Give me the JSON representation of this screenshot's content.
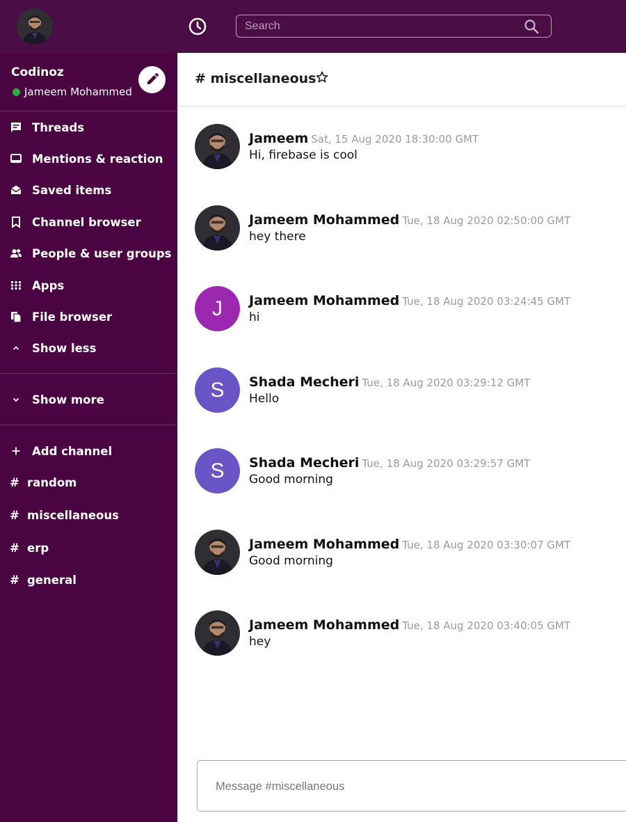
{
  "topbar": {
    "search_placeholder": "Search"
  },
  "sidebar": {
    "workspace_name": "Codinoz",
    "current_user": "Jameem Mohammed",
    "nav_items": [
      {
        "label": "Threads",
        "icon": "threads-icon"
      },
      {
        "label": "Mentions & reaction",
        "icon": "mentions-icon"
      },
      {
        "label": "Saved items",
        "icon": "saved-items-icon"
      },
      {
        "label": "Channel browser",
        "icon": "bookmark-icon"
      },
      {
        "label": "People & user groups",
        "icon": "people-icon"
      },
      {
        "label": "Apps",
        "icon": "apps-grid-icon"
      },
      {
        "label": "File browser",
        "icon": "files-icon"
      },
      {
        "label": "Show less",
        "icon": "chevron-up-icon"
      }
    ],
    "show_more": "Show more",
    "add_channel": "Add channel",
    "channels": [
      "random",
      "miscellaneous",
      "erp",
      "general"
    ]
  },
  "channel": {
    "title": "# miscellaneous"
  },
  "messages": [
    {
      "author": "Jameem",
      "time": "Sat, 15 Aug 2020 18:30:00 GMT",
      "text": "Hi, firebase is cool",
      "avatar": "photo"
    },
    {
      "author": "Jameem Mohammed",
      "time": "Tue, 18 Aug 2020 02:50:00 GMT",
      "text": "hey there",
      "avatar": "photo"
    },
    {
      "author": "Jameem Mohammed",
      "time": "Tue, 18 Aug 2020 03:24:45 GMT",
      "text": "hi",
      "avatar": "J",
      "avatar_color": "#9c27b0"
    },
    {
      "author": "Shada Mecheri",
      "time": "Tue, 18 Aug 2020 03:29:12 GMT",
      "text": "Hello",
      "avatar": "S",
      "avatar_color": "#6a55c7"
    },
    {
      "author": "Shada Mecheri",
      "time": "Tue, 18 Aug 2020 03:29:57 GMT",
      "text": "Good morning",
      "avatar": "S",
      "avatar_color": "#6a55c7"
    },
    {
      "author": "Jameem Mohammed",
      "time": "Tue, 18 Aug 2020 03:30:07 GMT",
      "text": "Good morning",
      "avatar": "photo"
    },
    {
      "author": "Jameem Mohammed",
      "time": "Tue, 18 Aug 2020 03:40:05 GMT",
      "text": "hey",
      "avatar": "photo"
    }
  ],
  "composer": {
    "placeholder": "Message #miscellaneous"
  },
  "colors": {
    "sidebar_bg": "#4a0442",
    "topbar_bg": "#4a0d45",
    "online": "#2bac3f"
  }
}
